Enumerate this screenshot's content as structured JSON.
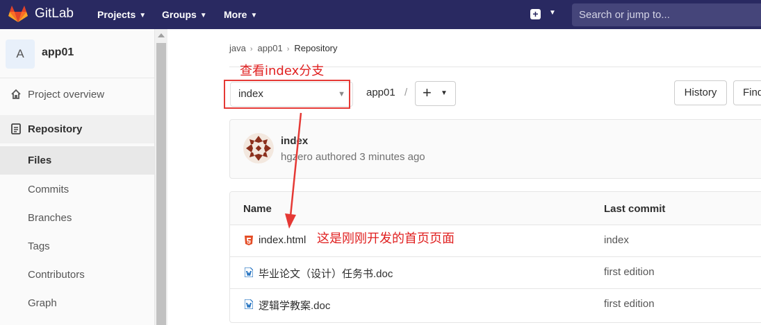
{
  "topnav": {
    "brand": "GitLab",
    "projects": "Projects",
    "groups": "Groups",
    "more": "More",
    "search_placeholder": "Search or jump to..."
  },
  "sidebar": {
    "project_initial": "A",
    "project_name": "app01",
    "items": [
      {
        "label": "Project overview",
        "icon": "home-icon"
      },
      {
        "label": "Repository",
        "icon": "repository-icon"
      },
      {
        "label": "Files"
      },
      {
        "label": "Commits"
      },
      {
        "label": "Branches"
      },
      {
        "label": "Tags"
      },
      {
        "label": "Contributors"
      },
      {
        "label": "Graph"
      }
    ]
  },
  "breadcrumb": [
    "java",
    "app01",
    "Repository"
  ],
  "annotations": {
    "branch_note": "查看index分支",
    "file_note": "这是刚刚开发的首页页面"
  },
  "toolbar": {
    "branch": "index",
    "path": "app01",
    "slash": "/",
    "history": "History",
    "find": "Find"
  },
  "commit": {
    "title": "index",
    "meta": "hgzero authored 3 minutes ago"
  },
  "tree": {
    "headers": {
      "name": "Name",
      "last_commit": "Last commit"
    },
    "rows": [
      {
        "name": "index.html",
        "last_commit": "index",
        "icon": "html5-file-icon"
      },
      {
        "name": "毕业论文（设计）任务书.doc",
        "last_commit": "first edition",
        "icon": "word-file-icon"
      },
      {
        "name": "逻辑学教案.doc",
        "last_commit": "first edition",
        "icon": "word-file-icon"
      }
    ]
  },
  "colors": {
    "nav_bg": "#292961",
    "annotation_red": "#e02020"
  }
}
